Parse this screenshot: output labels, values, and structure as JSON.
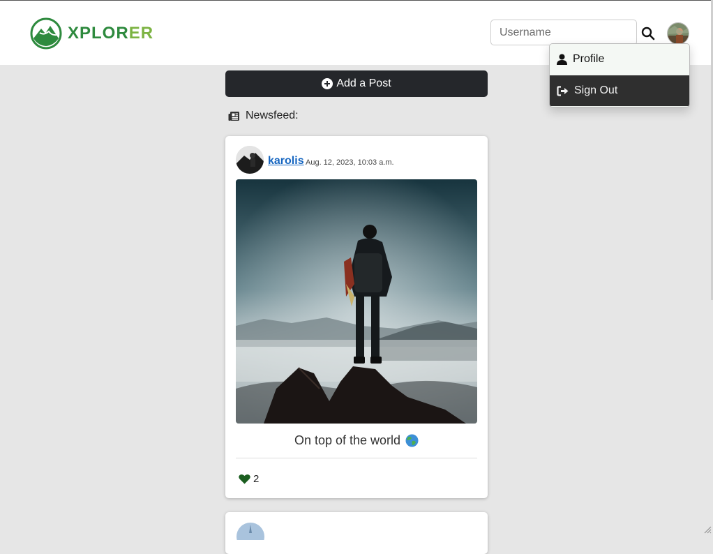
{
  "brand": {
    "name_part1": "XPLOR",
    "name_part2": "ER",
    "logo_icon": "mountain-logo-icon",
    "primary_color": "#2e8a3e",
    "accent_color": "#7cb342"
  },
  "search": {
    "placeholder": "Username",
    "icon": "search-icon"
  },
  "user_menu": {
    "profile_label": "Profile",
    "profile_icon": "user-icon",
    "signout_label": "Sign Out",
    "signout_icon": "sign-out-icon"
  },
  "add_post": {
    "label": "Add a Post",
    "icon": "plus-circle-icon"
  },
  "newsfeed": {
    "label": "Newsfeed:",
    "icon": "newspaper-icon"
  },
  "posts": [
    {
      "username": "karolis",
      "date": "Aug. 12, 2023, 10:03 a.m.",
      "caption": "On top of the world",
      "caption_emoji": "globe-icon",
      "likes": "2",
      "like_icon": "heart-icon",
      "like_color": "#1b5e20"
    }
  ]
}
